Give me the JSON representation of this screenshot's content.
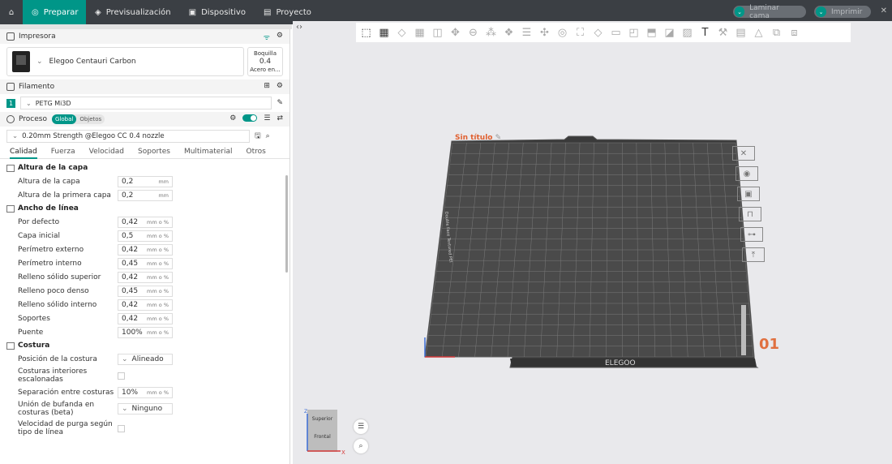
{
  "topbar": {
    "tabs": [
      {
        "label": "Preparar",
        "active": true
      },
      {
        "label": "Previsualización"
      },
      {
        "label": "Dispositivo"
      },
      {
        "label": "Proyecto"
      }
    ],
    "slice_label": "Laminar cama",
    "print_label": "Imprimir"
  },
  "printer": {
    "title": "Impresora",
    "name": "Elegoo Centauri Carbon",
    "nozzle_label": "Boquilla",
    "nozzle_value": "0.4",
    "nozzle_material": "Acero en..."
  },
  "filament": {
    "title": "Filamento",
    "slot": "1",
    "name": "PETG Mi3D"
  },
  "process": {
    "title": "Proceso",
    "global_label": "Global",
    "objects_label": "Objetos",
    "preset": "0.20mm Strength @Elegoo CC 0.4 nozzle"
  },
  "tabs": [
    "Calidad",
    "Fuerza",
    "Velocidad",
    "Soportes",
    "Multimaterial",
    "Otros"
  ],
  "groups": {
    "layer_height": {
      "title": "Altura de la capa",
      "rows": [
        {
          "label": "Altura de la capa",
          "value": "0,2",
          "unit": "mm"
        },
        {
          "label": "Altura de la primera capa",
          "value": "0,2",
          "unit": "mm"
        }
      ]
    },
    "line_width": {
      "title": "Ancho de línea",
      "rows": [
        {
          "label": "Por defecto",
          "value": "0,42",
          "unit": "mm o %"
        },
        {
          "label": "Capa inicial",
          "value": "0,5",
          "unit": "mm o %"
        },
        {
          "label": "Perímetro externo",
          "value": "0,42",
          "unit": "mm o %"
        },
        {
          "label": "Perímetro interno",
          "value": "0,45",
          "unit": "mm o %"
        },
        {
          "label": "Relleno sólido superior",
          "value": "0,42",
          "unit": "mm o %"
        },
        {
          "label": "Relleno poco denso",
          "value": "0,45",
          "unit": "mm o %"
        },
        {
          "label": "Relleno sólido interno",
          "value": "0,42",
          "unit": "mm o %"
        },
        {
          "label": "Soportes",
          "value": "0,42",
          "unit": "mm o %"
        },
        {
          "label": "Puente",
          "value": "100%",
          "unit": "mm o %"
        }
      ]
    },
    "seam": {
      "title": "Costura",
      "position_label": "Posición de la costura",
      "position_value": "Alineado",
      "staggered_label": "Costuras interiores escalonadas",
      "gap_label": "Separación entre costuras",
      "gap_value": "10%",
      "gap_unit": "mm o %",
      "scarf_label": "Unión de bufanda en costuras (beta)",
      "scarf_value": "Ninguno",
      "wipe_label": "Velocidad de purga según tipo de línea"
    }
  },
  "viewport": {
    "plate_title": "Sin título",
    "plate_number": "01",
    "bed_brand": "ELEGOO",
    "bed_side_text": "Double Face Textured PEI",
    "cube_top": "Superior",
    "cube_front": "Frontal",
    "axis_x": "X",
    "axis_z": "Z"
  }
}
